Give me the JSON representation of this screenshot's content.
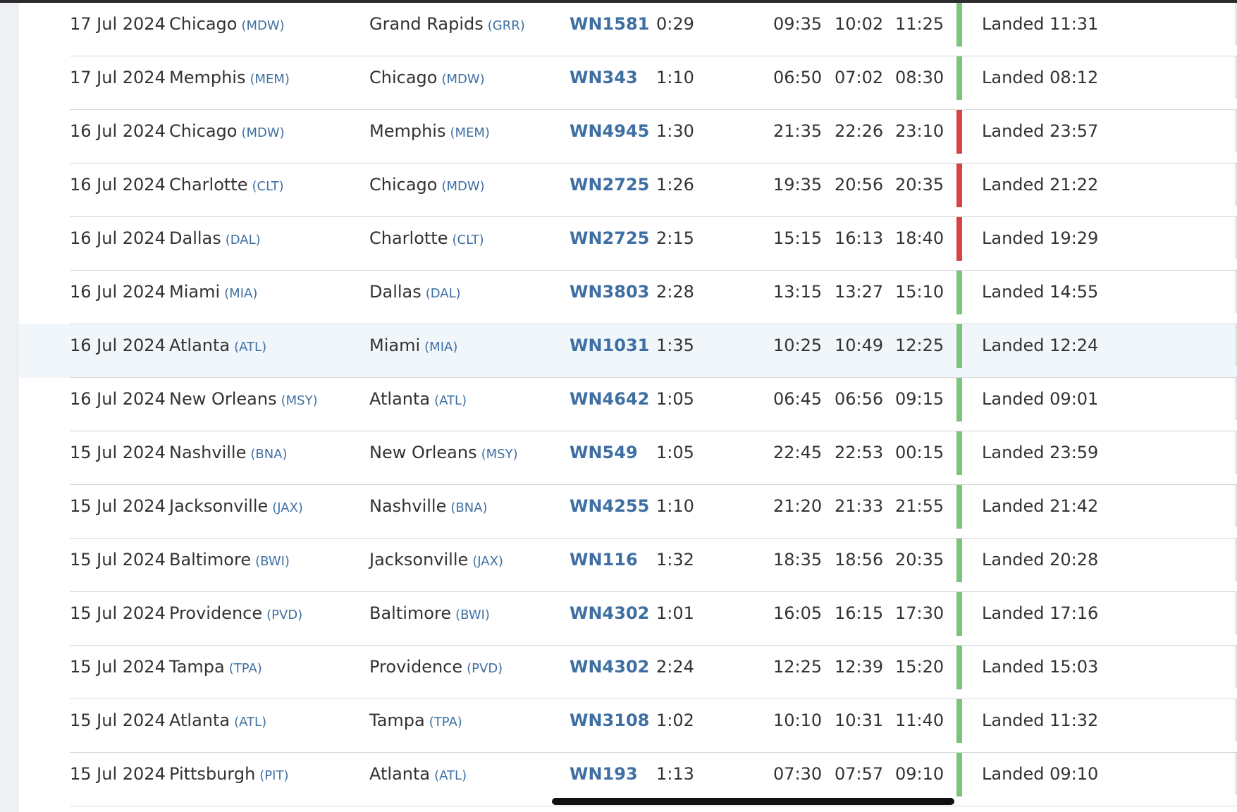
{
  "colors": {
    "on_time": "#7cc47b",
    "delayed": "#d64545",
    "accent": "#3e6fa3"
  },
  "flights": [
    {
      "date": "17 Jul 2024",
      "from_city": "Chicago",
      "from_code": "(MDW)",
      "to_city": "Grand Rapids",
      "to_code": "(GRR)",
      "flight": "WN1581",
      "duration": "0:29",
      "std": "09:35",
      "atd": "10:02",
      "sta": "11:25",
      "status": "Landed 11:31",
      "status_color": "#7cc47b"
    },
    {
      "date": "17 Jul 2024",
      "from_city": "Memphis",
      "from_code": "(MEM)",
      "to_city": "Chicago",
      "to_code": "(MDW)",
      "flight": "WN343",
      "duration": "1:10",
      "std": "06:50",
      "atd": "07:02",
      "sta": "08:30",
      "status": "Landed 08:12",
      "status_color": "#7cc47b"
    },
    {
      "date": "16 Jul 2024",
      "from_city": "Chicago",
      "from_code": "(MDW)",
      "to_city": "Memphis",
      "to_code": "(MEM)",
      "flight": "WN4945",
      "duration": "1:30",
      "std": "21:35",
      "atd": "22:26",
      "sta": "23:10",
      "status": "Landed 23:57",
      "status_color": "#d64545"
    },
    {
      "date": "16 Jul 2024",
      "from_city": "Charlotte",
      "from_code": "(CLT)",
      "to_city": "Chicago",
      "to_code": "(MDW)",
      "flight": "WN2725",
      "duration": "1:26",
      "std": "19:35",
      "atd": "20:56",
      "sta": "20:35",
      "status": "Landed 21:22",
      "status_color": "#d64545"
    },
    {
      "date": "16 Jul 2024",
      "from_city": "Dallas",
      "from_code": "(DAL)",
      "to_city": "Charlotte",
      "to_code": "(CLT)",
      "flight": "WN2725",
      "duration": "2:15",
      "std": "15:15",
      "atd": "16:13",
      "sta": "18:40",
      "status": "Landed 19:29",
      "status_color": "#d64545"
    },
    {
      "date": "16 Jul 2024",
      "from_city": "Miami",
      "from_code": "(MIA)",
      "to_city": "Dallas",
      "to_code": "(DAL)",
      "flight": "WN3803",
      "duration": "2:28",
      "std": "13:15",
      "atd": "13:27",
      "sta": "15:10",
      "status": "Landed 14:55",
      "status_color": "#7cc47b"
    },
    {
      "date": "16 Jul 2024",
      "from_city": "Atlanta",
      "from_code": "(ATL)",
      "to_city": "Miami",
      "to_code": "(MIA)",
      "flight": "WN1031",
      "duration": "1:35",
      "std": "10:25",
      "atd": "10:49",
      "sta": "12:25",
      "status": "Landed 12:24",
      "status_color": "#7cc47b",
      "highlighted": true
    },
    {
      "date": "16 Jul 2024",
      "from_city": "New Orleans",
      "from_code": "(MSY)",
      "to_city": "Atlanta",
      "to_code": "(ATL)",
      "flight": "WN4642",
      "duration": "1:05",
      "std": "06:45",
      "atd": "06:56",
      "sta": "09:15",
      "status": "Landed 09:01",
      "status_color": "#7cc47b"
    },
    {
      "date": "15 Jul 2024",
      "from_city": "Nashville",
      "from_code": "(BNA)",
      "to_city": "New Orleans",
      "to_code": "(MSY)",
      "flight": "WN549",
      "duration": "1:05",
      "std": "22:45",
      "atd": "22:53",
      "sta": "00:15",
      "status": "Landed 23:59",
      "status_color": "#7cc47b"
    },
    {
      "date": "15 Jul 2024",
      "from_city": "Jacksonville",
      "from_code": "(JAX)",
      "to_city": "Nashville",
      "to_code": "(BNA)",
      "flight": "WN4255",
      "duration": "1:10",
      "std": "21:20",
      "atd": "21:33",
      "sta": "21:55",
      "status": "Landed 21:42",
      "status_color": "#7cc47b"
    },
    {
      "date": "15 Jul 2024",
      "from_city": "Baltimore",
      "from_code": "(BWI)",
      "to_city": "Jacksonville",
      "to_code": "(JAX)",
      "flight": "WN116",
      "duration": "1:32",
      "std": "18:35",
      "atd": "18:56",
      "sta": "20:35",
      "status": "Landed 20:28",
      "status_color": "#7cc47b"
    },
    {
      "date": "15 Jul 2024",
      "from_city": "Providence",
      "from_code": "(PVD)",
      "to_city": "Baltimore",
      "to_code": "(BWI)",
      "flight": "WN4302",
      "duration": "1:01",
      "std": "16:05",
      "atd": "16:15",
      "sta": "17:30",
      "status": "Landed 17:16",
      "status_color": "#7cc47b"
    },
    {
      "date": "15 Jul 2024",
      "from_city": "Tampa",
      "from_code": "(TPA)",
      "to_city": "Providence",
      "to_code": "(PVD)",
      "flight": "WN4302",
      "duration": "2:24",
      "std": "12:25",
      "atd": "12:39",
      "sta": "15:20",
      "status": "Landed 15:03",
      "status_color": "#7cc47b"
    },
    {
      "date": "15 Jul 2024",
      "from_city": "Atlanta",
      "from_code": "(ATL)",
      "to_city": "Tampa",
      "to_code": "(TPA)",
      "flight": "WN3108",
      "duration": "1:02",
      "std": "10:10",
      "atd": "10:31",
      "sta": "11:40",
      "status": "Landed 11:32",
      "status_color": "#7cc47b"
    },
    {
      "date": "15 Jul 2024",
      "from_city": "Pittsburgh",
      "from_code": "(PIT)",
      "to_city": "Atlanta",
      "to_code": "(ATL)",
      "flight": "WN193",
      "duration": "1:13",
      "std": "07:30",
      "atd": "07:57",
      "sta": "09:10",
      "status": "Landed 09:10",
      "status_color": "#7cc47b"
    }
  ]
}
